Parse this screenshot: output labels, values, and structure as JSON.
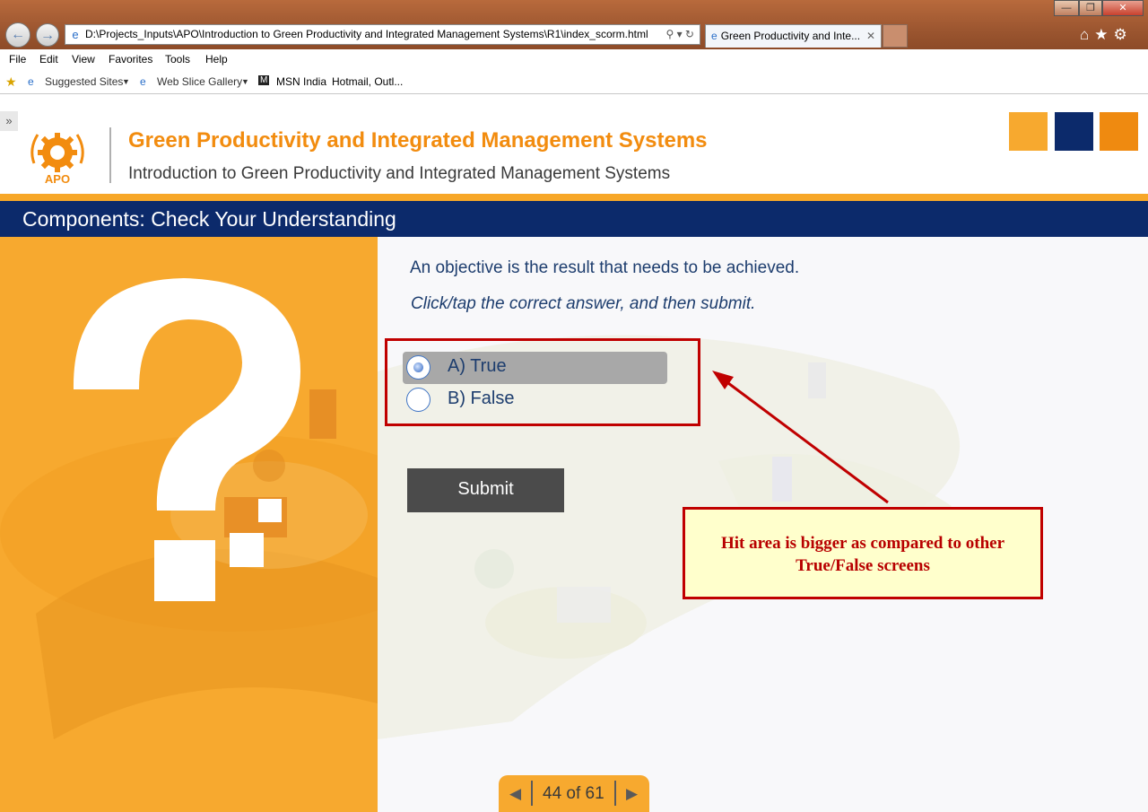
{
  "browser": {
    "address": "D:\\Projects_Inputs\\APO\\Introduction to Green Productivity and Integrated Management Systems\\R1\\index_scorm.html",
    "tab_title": "Green Productivity and Inte...",
    "menu": [
      "File",
      "Edit",
      "View",
      "Favorites",
      "Tools",
      "Help"
    ],
    "favorites": [
      "Suggested Sites",
      "Web Slice Gallery",
      "MSN India",
      "Hotmail, Outl..."
    ]
  },
  "header": {
    "logo_text": "APO",
    "title": "Green Productivity and Integrated Management Systems",
    "subtitle": "Introduction to Green Productivity and Integrated Management Systems",
    "squares": [
      "#f7a92f",
      "#0c2a6b",
      "#ef8a10"
    ]
  },
  "section_title": "Components: Check Your Understanding",
  "question": {
    "text": "An objective is the result that needs to be achieved.",
    "instruction": "Click/tap the correct answer, and then submit.",
    "options": [
      {
        "label": "A) True",
        "selected": true
      },
      {
        "label": "B) False",
        "selected": false
      }
    ],
    "submit_label": "Submit"
  },
  "callout": {
    "text": "Hit area is bigger as compared to other True/False screens"
  },
  "pager": {
    "current": "44 of 61"
  },
  "colors": {
    "accent_orange": "#f28c0f",
    "navy": "#0c2a6b",
    "annotation_red": "#c00000"
  }
}
